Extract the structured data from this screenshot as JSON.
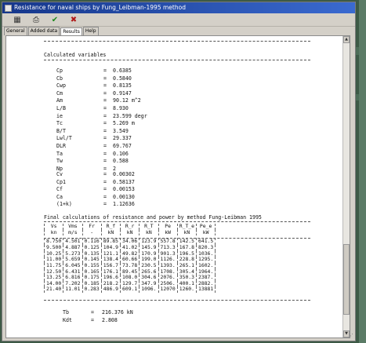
{
  "window": {
    "title": "Resistance for naval ships by Fung_Leibman-1995 method"
  },
  "toolbar": {
    "calc_icon": "calculator-icon",
    "print_icon": "printer-icon",
    "ok_icon": "checkmark-icon",
    "cancel_icon": "x-icon",
    "ok_glyph": "✔",
    "cancel_glyph": "✖",
    "calc_glyph": "▦",
    "print_glyph": "⎙"
  },
  "tabs": [
    {
      "label": "General"
    },
    {
      "label": "Added data"
    },
    {
      "label": "Results"
    },
    {
      "label": "Help"
    }
  ],
  "report": {
    "heading1": "Calculated variables",
    "variables": [
      {
        "name": "Cp",
        "value": "0.6385"
      },
      {
        "name": "Cb",
        "value": "0.5840"
      },
      {
        "name": "Cwp",
        "value": "0.8135"
      },
      {
        "name": "Cm",
        "value": "0.9147"
      },
      {
        "name": "Am",
        "value": "90.12 m^2"
      },
      {
        "name": "L/B",
        "value": "8.930"
      },
      {
        "name": "ie",
        "value": "23.599 degr"
      },
      {
        "name": "Tc",
        "value": "5.269 m"
      },
      {
        "name": "B/T",
        "value": "3.549"
      },
      {
        "name": "Lwl/T",
        "value": "29.337"
      },
      {
        "name": "DLR",
        "value": "69.767"
      },
      {
        "name": "Ta",
        "value": "0.106"
      },
      {
        "name": "Tw",
        "value": "0.588"
      },
      {
        "name": "Np",
        "value": "2"
      }
    ],
    "coefficients": [
      {
        "name": "Cv",
        "value": "0.00302"
      },
      {
        "name": "Cp1",
        "value": "0.58137"
      },
      {
        "name": "Cf",
        "value": "0.00153"
      },
      {
        "name": "Ca",
        "value": "0.00130"
      },
      {
        "name": "(1+k)",
        "value": "1.12636"
      }
    ],
    "heading2": "Final calculations of resistance and power by method Fung-Leibman 1995",
    "table": {
      "headers": [
        "Vs",
        "Vms",
        "Fr",
        "R_f",
        "R_r",
        "R_T",
        "Pe",
        "R_T_e",
        "Pe_e"
      ],
      "units": [
        "kn",
        "m/s",
        "-",
        "kN",
        "kN",
        "kN",
        "kW",
        "kN",
        "kW"
      ],
      "rows": [
        [
          "8.750",
          "4.501",
          "0.116",
          "89.85",
          "34.06",
          "123.9",
          "557.8",
          "142.5",
          "641.5"
        ],
        [
          "9.500",
          "4.887",
          "0.125",
          "104.9",
          "41.02",
          "145.9",
          "713.3",
          "167.8",
          "820.3"
        ],
        [
          "10.25",
          "5.273",
          "0.135",
          "121.1",
          "49.82",
          "170.9",
          "901.3",
          "196.5",
          "1036."
        ],
        [
          "11.00",
          "5.659",
          "0.145",
          "138.4",
          "60.66",
          "199.0",
          "1126.",
          "228.8",
          "1295."
        ],
        [
          "11.75",
          "6.045",
          "0.155",
          "156.7",
          "73.78",
          "230.5",
          "1393.",
          "265.1",
          "1602."
        ],
        [
          "12.50",
          "6.431",
          "0.165",
          "176.1",
          "89.45",
          "265.6",
          "1708.",
          "305.4",
          "1964."
        ],
        [
          "13.25",
          "6.816",
          "0.175",
          "196.6",
          "108.0",
          "304.6",
          "2076.",
          "350.3",
          "2387."
        ],
        [
          "14.00",
          "7.202",
          "0.185",
          "218.2",
          "129.7",
          "347.9",
          "2506.",
          "400.1",
          "2882."
        ],
        [
          "21.40",
          "11.01",
          "0.283",
          "486.9",
          "609.1",
          "1096.",
          "12070",
          "1260.",
          "13881"
        ]
      ]
    },
    "footer": [
      {
        "name": "Tb",
        "value": "216.376 kN"
      },
      {
        "name": "Kdt",
        "value": "2.808"
      }
    ]
  }
}
